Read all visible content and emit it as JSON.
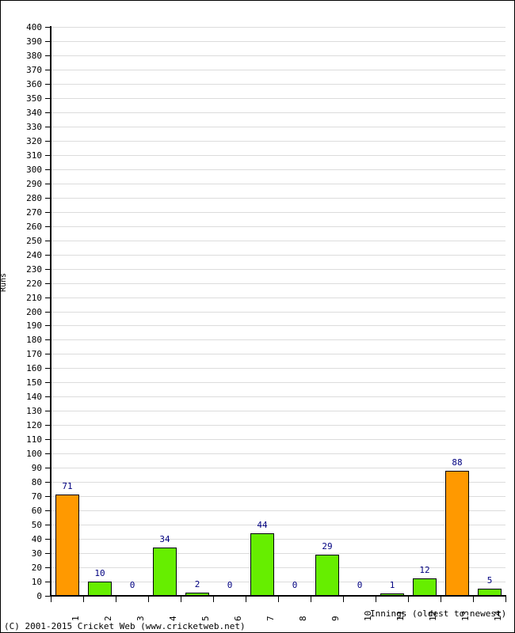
{
  "footer": {
    "credit": "(C) 2001-2015 Cricket Web (www.cricketweb.net)"
  },
  "colors": {
    "bar_low": "#66EE00",
    "bar_high": "#FF9900",
    "bar_border": "#000000",
    "gridline": "#DCDCDC",
    "value_label": "#000080",
    "axis": "#000000"
  },
  "chart_data": {
    "type": "bar",
    "title": "",
    "xlabel": "Innings (oldest to newest)",
    "ylabel": "Runs",
    "categories": [
      "1",
      "2",
      "3",
      "4",
      "5",
      "6",
      "7",
      "8",
      "9",
      "10",
      "11",
      "12",
      "13",
      "14"
    ],
    "values": [
      71,
      10,
      0,
      34,
      2,
      0,
      44,
      0,
      29,
      0,
      1,
      12,
      88,
      5
    ],
    "bar_colors": [
      "#FF9900",
      "#66EE00",
      "#66EE00",
      "#66EE00",
      "#66EE00",
      "#66EE00",
      "#66EE00",
      "#66EE00",
      "#66EE00",
      "#66EE00",
      "#66EE00",
      "#66EE00",
      "#FF9900",
      "#66EE00"
    ],
    "value_labels": [
      "71",
      "10",
      "0",
      "34",
      "2",
      "0",
      "44",
      "0",
      "29",
      "0",
      "1",
      "12",
      "88",
      "5"
    ],
    "ylim": [
      0,
      400
    ],
    "ytick_step": 10,
    "yticks": [
      "0",
      "10",
      "20",
      "30",
      "40",
      "50",
      "60",
      "70",
      "80",
      "90",
      "100",
      "110",
      "120",
      "130",
      "140",
      "150",
      "160",
      "170",
      "180",
      "190",
      "200",
      "210",
      "220",
      "230",
      "240",
      "250",
      "260",
      "270",
      "280",
      "290",
      "300",
      "310",
      "320",
      "330",
      "340",
      "350",
      "360",
      "370",
      "380",
      "390",
      "400"
    ],
    "grid": true,
    "legend": false,
    "highlight_threshold": 50
  }
}
